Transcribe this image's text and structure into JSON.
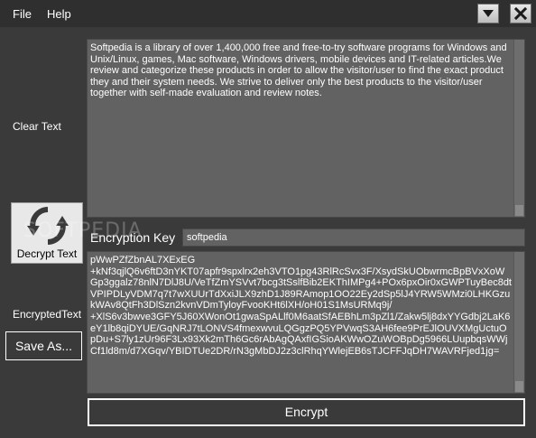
{
  "menu": {
    "file": "File",
    "help": "Help"
  },
  "window_controls": {
    "minimize_icon": "chevron-down-icon",
    "close_icon": "close-icon"
  },
  "labels": {
    "clear_text": "Clear Text",
    "encrypted_text": "EncryptedText",
    "encryption_key": "Encryption Key"
  },
  "clear_text": "Softpedia is a library of over 1,400,000 free and free-to-try software programs for Windows and Unix/Linux, games, Mac software, Windows drivers, mobile devices and IT-related articles.We review and categorize these products in order to allow the visitor/user to find the exact product they and their system needs. We strive to deliver only the best products to the visitor/user together with self-made evaluation and review notes.",
  "encryption_key": "softpedia",
  "encrypted_text": "pWwPZfZbnAL7XExEG\n+kNf3qjlQ6v6ftD3nYKT07apfr9spxlrx2eh3VTO1pg43RlRcSvx3F/XsydSkUObwrmcBpBVxXoWGp3ggalz78nlN7DlJ8U/VeTfZmYSVvt7bcg3tSslfBib2EKThIMPg4+POx6pxOir0xGWPTuyBec8dtVPIPDLyVDM7q7t7wXUUrTdXxiJLX9zhD1J89RAmop1OO22Ey2dSp5lJ4YRW5WMzi0LHKGzukWAv8QtFh3DlSzn2kvnVDmTyloyFvooKHt6lXH/oH01S1MsURMq9j/\n+XlS6v3bwve3GFY5J60XWonOt1gwaSpALlf0M6aatSfAEBhLm3pZl1/Zakw5lj8dxYYGdbj2LaK6eY1lb8qiDYUE/GqNRJ7tLONVS4fmexwvuLQGgzPQ5YPVwqS3AH6fee9PrEJlOUVXMgUctuOpDu+S7ly1zUr96F3Lx93Xk2mTh6Gc6rAbAgQAxfIGSioAKWwOZuWOBpDg5966LUupbqsWWjCf1ld8m/d7XGqv/YBIDTUe2DR/rN3gMbDJ2z3clRhqYWlejEB6sTJCFFJqDH7WAVRFjed1jg=",
  "buttons": {
    "decrypt": "Decrypt Text",
    "save": "Save As...",
    "encrypt": "Encrypt"
  },
  "watermark": "SOFTPEDIA"
}
